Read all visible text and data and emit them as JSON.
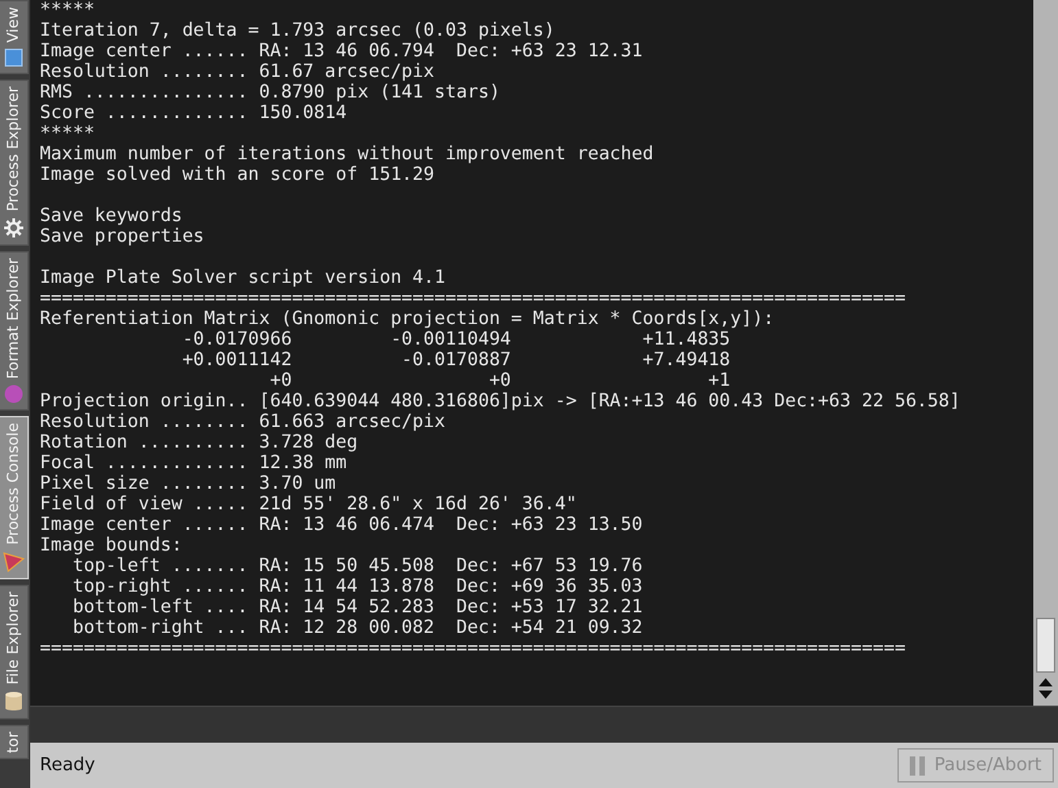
{
  "sidebar": {
    "tabs": [
      {
        "label": "View",
        "selected": false
      },
      {
        "label": "Process Explorer",
        "selected": false
      },
      {
        "label": "Format Explorer",
        "selected": false
      },
      {
        "label": "Process Console",
        "selected": true
      },
      {
        "label": "File Explorer",
        "selected": false
      },
      {
        "label": "tor",
        "selected": false
      }
    ]
  },
  "console": {
    "blocks": [
      [
        "*****",
        "Iteration 7, delta = 1.793 arcsec (0.03 pixels)",
        "Image center ...... RA: 13 46 06.794  Dec: +63 23 12.31",
        "Resolution ........ 61.67 arcsec/pix",
        "RMS ............... 0.8790 pix (141 stars)",
        "Score ............. 150.0814",
        "*****",
        "Maximum number of iterations without improvement reached",
        "Image solved with an score of 151.29"
      ],
      [
        "Save keywords",
        "Save properties"
      ],
      [
        "Image Plate Solver script version 4.1",
        "===============================================================================",
        "Referentiation Matrix (Gnomonic projection = Matrix * Coords[x,y]):",
        "             -0.0170966         -0.00110494            +11.4835",
        "             +0.0011142          -0.0170887            +7.49418",
        "                     +0                  +0                  +1",
        "Projection origin.. [640.639044 480.316806]pix -> [RA:+13 46 00.43 Dec:+63 22 56.58]",
        "Resolution ........ 61.663 arcsec/pix",
        "Rotation .......... 3.728 deg",
        "Focal ............. 12.38 mm",
        "Pixel size ........ 3.70 um",
        "Field of view ..... 21d 55' 28.6\" x 16d 26' 36.4\"",
        "Image center ...... RA: 13 46 06.474  Dec: +63 23 13.50",
        "Image bounds:",
        "   top-left ....... RA: 15 50 45.508  Dec: +67 53 19.76",
        "   top-right ...... RA: 11 44 13.878  Dec: +69 36 35.03",
        "   bottom-left .... RA: 14 54 52.283  Dec: +53 17 32.21",
        "   bottom-right ... RA: 12 28 00.082  Dec: +54 21 09.32",
        "==============================================================================="
      ]
    ]
  },
  "status_bar": {
    "text": "Ready",
    "button": {
      "label": "Pause/Abort",
      "disabled": true
    }
  }
}
